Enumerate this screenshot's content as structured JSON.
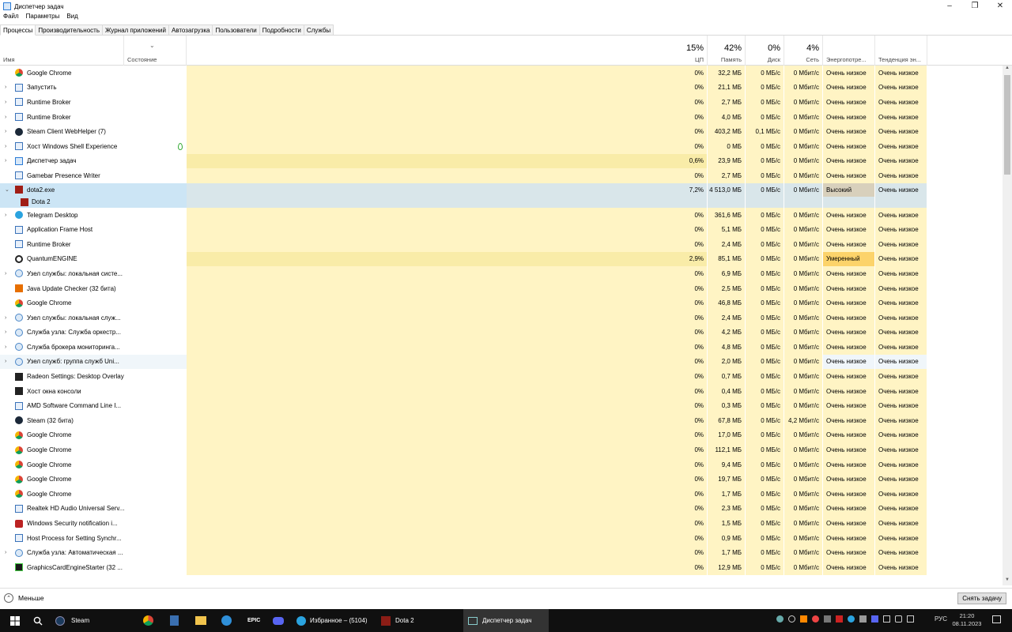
{
  "window": {
    "title": "Диспетчер задач",
    "minimize": "–",
    "maximize": "❐",
    "close": "✕"
  },
  "menu": [
    "Файл",
    "Параметры",
    "Вид"
  ],
  "tabs": [
    "Процессы",
    "Производительность",
    "Журнал приложений",
    "Автозагрузка",
    "Пользователи",
    "Подробности",
    "Службы"
  ],
  "header": {
    "name": "Имя",
    "status": "Состояние",
    "sort_icon": "chevron-down",
    "cpu": {
      "pct": "15%",
      "label": "ЦП"
    },
    "memory": {
      "pct": "42%",
      "label": "Память"
    },
    "disk": {
      "pct": "0%",
      "label": "Диск"
    },
    "network": {
      "pct": "4%",
      "label": "Сеть"
    },
    "power": "Энергопотре...",
    "power_trend": "Тенденция эн..."
  },
  "processes": [
    {
      "name": "Google Chrome",
      "expander": "",
      "icon": "chrome",
      "cpu": "0%",
      "mem": "32,2 МБ",
      "disk": "0 МБ/с",
      "net": "0 Мбит/с",
      "power": "Очень низкое",
      "trend": "Очень низкое"
    },
    {
      "name": "Запустить",
      "expander": "›",
      "icon": "app",
      "cpu": "0%",
      "mem": "21,1 МБ",
      "disk": "0 МБ/с",
      "net": "0 Мбит/с",
      "power": "Очень низкое",
      "trend": "Очень низкое"
    },
    {
      "name": "Runtime Broker",
      "expander": "›",
      "icon": "app",
      "cpu": "0%",
      "mem": "2,7 МБ",
      "disk": "0 МБ/с",
      "net": "0 Мбит/с",
      "power": "Очень низкое",
      "trend": "Очень низкое"
    },
    {
      "name": "Runtime Broker",
      "expander": "›",
      "icon": "app",
      "cpu": "0%",
      "mem": "4,0 МБ",
      "disk": "0 МБ/с",
      "net": "0 Мбит/с",
      "power": "Очень низкое",
      "trend": "Очень низкое"
    },
    {
      "name": "Steam Client WebHelper (7)",
      "expander": "›",
      "icon": "steam",
      "cpu": "0%",
      "mem": "403,2 МБ",
      "disk": "0,1 МБ/с",
      "net": "0 Мбит/с",
      "power": "Очень низкое",
      "trend": "Очень низкое"
    },
    {
      "name": "Хост Windows Shell Experience",
      "expander": "›",
      "icon": "app",
      "status_icon": "leaf",
      "cpu": "0%",
      "mem": "0 МБ",
      "disk": "0 МБ/с",
      "net": "0 Мбит/с",
      "power": "Очень низкое",
      "trend": "Очень низкое"
    },
    {
      "name": "Диспетчер задач",
      "expander": "›",
      "icon": "taskmgr",
      "cpu": "0,6%",
      "mem": "23,9 МБ",
      "disk": "0 МБ/с",
      "net": "0 Мбит/с",
      "power": "Очень низкое",
      "trend": "Очень низкое",
      "cpu_hi": true
    },
    {
      "name": "Gamebar Presence Writer",
      "expander": "",
      "icon": "app",
      "cpu": "0%",
      "mem": "2,7 МБ",
      "disk": "0 МБ/с",
      "net": "0 Мбит/с",
      "power": "Очень низкое",
      "trend": "Очень низкое"
    },
    {
      "name": "dota2.exe",
      "expander": "⌄",
      "icon": "dota",
      "cpu": "7,2%",
      "mem": "4 513,0 МБ",
      "disk": "0 МБ/с",
      "net": "0 Мбит/с",
      "power": "Высокий",
      "trend": "Очень низкое",
      "selected": true
    },
    {
      "name": "Dota 2",
      "expander": "",
      "icon": "dota",
      "child": true,
      "selected": true,
      "cpu": "",
      "mem": "",
      "disk": "",
      "net": "",
      "power": "",
      "trend": ""
    },
    {
      "name": "Telegram Desktop",
      "expander": "›",
      "icon": "telegram",
      "cpu": "0%",
      "mem": "361,6 МБ",
      "disk": "0 МБ/с",
      "net": "0 Мбит/с",
      "power": "Очень низкое",
      "trend": "Очень низкое"
    },
    {
      "name": "Application Frame Host",
      "expander": "",
      "icon": "app",
      "cpu": "0%",
      "mem": "5,1 МБ",
      "disk": "0 МБ/с",
      "net": "0 Мбит/с",
      "power": "Очень низкое",
      "trend": "Очень низкое"
    },
    {
      "name": "Runtime Broker",
      "expander": "",
      "icon": "app",
      "cpu": "0%",
      "mem": "2,4 МБ",
      "disk": "0 МБ/с",
      "net": "0 Мбит/с",
      "power": "Очень низкое",
      "trend": "Очень низкое"
    },
    {
      "name": "QuantumENGINE",
      "expander": "",
      "icon": "quantum",
      "cpu": "2,9%",
      "mem": "85,1 МБ",
      "disk": "0 МБ/с",
      "net": "0 Мбит/с",
      "power": "Умеренный",
      "trend": "Очень низкое",
      "cpu_hi": true,
      "moderate": true
    },
    {
      "name": "Узел службы: локальная систе...",
      "expander": "›",
      "icon": "gear",
      "cpu": "0%",
      "mem": "6,9 МБ",
      "disk": "0 МБ/с",
      "net": "0 Мбит/с",
      "power": "Очень низкое",
      "trend": "Очень низкое"
    },
    {
      "name": "Java Update Checker (32 бита)",
      "expander": "",
      "icon": "java",
      "cpu": "0%",
      "mem": "2,5 МБ",
      "disk": "0 МБ/с",
      "net": "0 Мбит/с",
      "power": "Очень низкое",
      "trend": "Очень низкое"
    },
    {
      "name": "Google Chrome",
      "expander": "",
      "icon": "chrome",
      "cpu": "0%",
      "mem": "46,8 МБ",
      "disk": "0 МБ/с",
      "net": "0 Мбит/с",
      "power": "Очень низкое",
      "trend": "Очень низкое"
    },
    {
      "name": "Узел службы: локальная служ...",
      "expander": "›",
      "icon": "gear",
      "cpu": "0%",
      "mem": "2,4 МБ",
      "disk": "0 МБ/с",
      "net": "0 Мбит/с",
      "power": "Очень низкое",
      "trend": "Очень низкое"
    },
    {
      "name": "Служба узла: Служба оркестр...",
      "expander": "›",
      "icon": "gear",
      "cpu": "0%",
      "mem": "4,2 МБ",
      "disk": "0 МБ/с",
      "net": "0 Мбит/с",
      "power": "Очень низкое",
      "trend": "Очень низкое"
    },
    {
      "name": "Служба брокера мониторинга...",
      "expander": "›",
      "icon": "gear",
      "cpu": "0%",
      "mem": "4,8 МБ",
      "disk": "0 МБ/с",
      "net": "0 Мбит/с",
      "power": "Очень низкое",
      "trend": "Очень низкое"
    },
    {
      "name": "Узел служб: группа служб Uni...",
      "expander": "›",
      "icon": "gear",
      "cpu": "0%",
      "mem": "2,0 МБ",
      "disk": "0 МБ/с",
      "net": "0 Мбит/с",
      "power": "Очень низкое",
      "trend": "Очень низкое",
      "hover": true
    },
    {
      "name": "Radeon Settings: Desktop Overlay",
      "expander": "",
      "icon": "app-dark",
      "cpu": "0%",
      "mem": "0,7 МБ",
      "disk": "0 МБ/с",
      "net": "0 Мбит/с",
      "power": "Очень низкое",
      "trend": "Очень низкое"
    },
    {
      "name": "Хост окна консоли",
      "expander": "",
      "icon": "app-dark",
      "cpu": "0%",
      "mem": "0,4 МБ",
      "disk": "0 МБ/с",
      "net": "0 Мбит/с",
      "power": "Очень низкое",
      "trend": "Очень низкое"
    },
    {
      "name": "AMD Software Command Line I...",
      "expander": "",
      "icon": "app",
      "cpu": "0%",
      "mem": "0,3 МБ",
      "disk": "0 МБ/с",
      "net": "0 Мбит/с",
      "power": "Очень низкое",
      "trend": "Очень низкое"
    },
    {
      "name": "Steam (32 бита)",
      "expander": "",
      "icon": "steam",
      "cpu": "0%",
      "mem": "67,8 МБ",
      "disk": "0 МБ/с",
      "net": "4,2 Мбит/с",
      "power": "Очень низкое",
      "trend": "Очень низкое"
    },
    {
      "name": "Google Chrome",
      "expander": "",
      "icon": "chrome",
      "cpu": "0%",
      "mem": "17,0 МБ",
      "disk": "0 МБ/с",
      "net": "0 Мбит/с",
      "power": "Очень низкое",
      "trend": "Очень низкое"
    },
    {
      "name": "Google Chrome",
      "expander": "",
      "icon": "chrome",
      "cpu": "0%",
      "mem": "112,1 МБ",
      "disk": "0 МБ/с",
      "net": "0 Мбит/с",
      "power": "Очень низкое",
      "trend": "Очень низкое"
    },
    {
      "name": "Google Chrome",
      "expander": "",
      "icon": "chrome",
      "cpu": "0%",
      "mem": "9,4 МБ",
      "disk": "0 МБ/с",
      "net": "0 Мбит/с",
      "power": "Очень низкое",
      "trend": "Очень низкое"
    },
    {
      "name": "Google Chrome",
      "expander": "",
      "icon": "chrome",
      "cpu": "0%",
      "mem": "19,7 МБ",
      "disk": "0 МБ/с",
      "net": "0 Мбит/с",
      "power": "Очень низкое",
      "trend": "Очень низкое"
    },
    {
      "name": "Google Chrome",
      "expander": "",
      "icon": "chrome",
      "cpu": "0%",
      "mem": "1,7 МБ",
      "disk": "0 МБ/с",
      "net": "0 Мбит/с",
      "power": "Очень низкое",
      "trend": "Очень низкое"
    },
    {
      "name": "Realtek HD Audio Universal Serv...",
      "expander": "",
      "icon": "app",
      "cpu": "0%",
      "mem": "2,3 МБ",
      "disk": "0 МБ/с",
      "net": "0 Мбит/с",
      "power": "Очень низкое",
      "trend": "Очень низкое"
    },
    {
      "name": "Windows Security notification i...",
      "expander": "",
      "icon": "shield",
      "cpu": "0%",
      "mem": "1,5 МБ",
      "disk": "0 МБ/с",
      "net": "0 Мбит/с",
      "power": "Очень низкое",
      "trend": "Очень низкое"
    },
    {
      "name": "Host Process for Setting Synchr...",
      "expander": "",
      "icon": "app",
      "cpu": "0%",
      "mem": "0,9 МБ",
      "disk": "0 МБ/с",
      "net": "0 Мбит/с",
      "power": "Очень низкое",
      "trend": "Очень низкое"
    },
    {
      "name": "Служба узла: Автоматическая ...",
      "expander": "›",
      "icon": "gear",
      "cpu": "0%",
      "mem": "1,7 МБ",
      "disk": "0 МБ/с",
      "net": "0 Мбит/с",
      "power": "Очень низкое",
      "trend": "Очень низкое"
    },
    {
      "name": "GraphicsCardEngineStarter (32 ...",
      "expander": "",
      "icon": "amd",
      "cpu": "0%",
      "mem": "12,9 МБ",
      "disk": "0 МБ/с",
      "net": "0 Мбит/с",
      "power": "Очень низкое",
      "trend": "Очень низкое"
    }
  ],
  "footer": {
    "less_label": "Меньше",
    "end_task": "Снять задачу"
  },
  "taskbar": {
    "items": [
      {
        "label": "Steam",
        "icon": "steam"
      },
      {
        "label": "",
        "icon": "chrome"
      },
      {
        "label": "",
        "icon": "calculator"
      },
      {
        "label": "",
        "icon": "folder"
      },
      {
        "label": "",
        "icon": "globe"
      },
      {
        "label": "EPIC",
        "icon": "epic"
      },
      {
        "label": "",
        "icon": "discord"
      },
      {
        "label": "Избранное – (5104)",
        "icon": "telegram"
      },
      {
        "label": "Dota 2",
        "icon": "dota"
      },
      {
        "label": "Диспетчер задач",
        "icon": "taskmgr"
      }
    ],
    "lang": "РУС",
    "time": "21:20",
    "date": "08.11.2023"
  },
  "colors": {
    "usage_light": "#fff4c4",
    "usage_dark": "#f9eca8",
    "selected": "#cce5f5",
    "moderate": "#fcd36a",
    "high": "#d8d0bc"
  }
}
